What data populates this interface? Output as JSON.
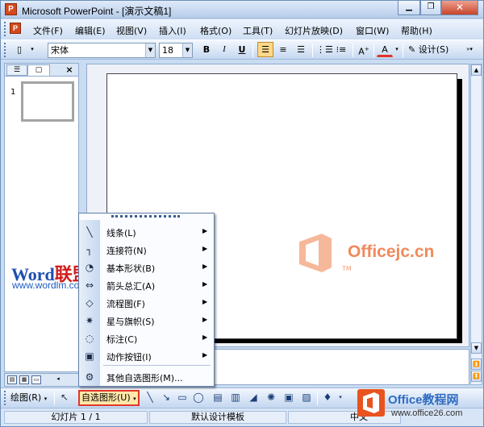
{
  "window": {
    "title": "Microsoft PowerPoint - [演示文稿1]",
    "app_icon_letter": "P"
  },
  "menubar": {
    "items": [
      "文件(F)",
      "编辑(E)",
      "视图(V)",
      "插入(I)",
      "格式(O)",
      "工具(T)",
      "幻灯片放映(D)",
      "窗口(W)",
      "帮助(H)"
    ]
  },
  "format_toolbar": {
    "font_name": "宋体",
    "font_size": "18",
    "bold": "B",
    "italic": "I",
    "underline": "U",
    "design_label": "设计(S)"
  },
  "side_pane": {
    "slide_number": "1",
    "close_glyph": "×"
  },
  "watermark": {
    "word": "Word",
    "word_cn": "联盟",
    "url": "www.wordlm.com"
  },
  "office_watermark": {
    "text": "Officejc.cn",
    "tm": "TM"
  },
  "autoshape_menu": {
    "items": [
      {
        "label": "线条(L)",
        "icon": "line-icon",
        "glyph": "╲"
      },
      {
        "label": "连接符(N)",
        "icon": "connector-icon",
        "glyph": "┐"
      },
      {
        "label": "基本形状(B)",
        "icon": "basic-shape-icon",
        "glyph": "◔"
      },
      {
        "label": "箭头总汇(A)",
        "icon": "block-arrow-icon",
        "glyph": "⇔"
      },
      {
        "label": "流程图(F)",
        "icon": "flowchart-icon",
        "glyph": "◇"
      },
      {
        "label": "星与旗帜(S)",
        "icon": "star-icon",
        "glyph": "✷"
      },
      {
        "label": "标注(C)",
        "icon": "callout-icon",
        "glyph": "◌"
      },
      {
        "label": "动作按钮(I)",
        "icon": "action-button-icon",
        "glyph": "▣"
      }
    ],
    "more_label": "其他自选图形(M)..."
  },
  "drawing_toolbar": {
    "draw_label": "绘图(R)",
    "autoshape_label": "自选图形(U)"
  },
  "statusbar": {
    "slide_info": "幻灯片 1 / 1",
    "template": "默认设计模板",
    "language": "中文"
  },
  "corner_logo": {
    "title": "Office教程网",
    "url": "www.office26.com"
  },
  "colors": {
    "accent_red": "#e0362a",
    "office_orange": "#f08a5b",
    "highlight": "#ffd88a"
  }
}
